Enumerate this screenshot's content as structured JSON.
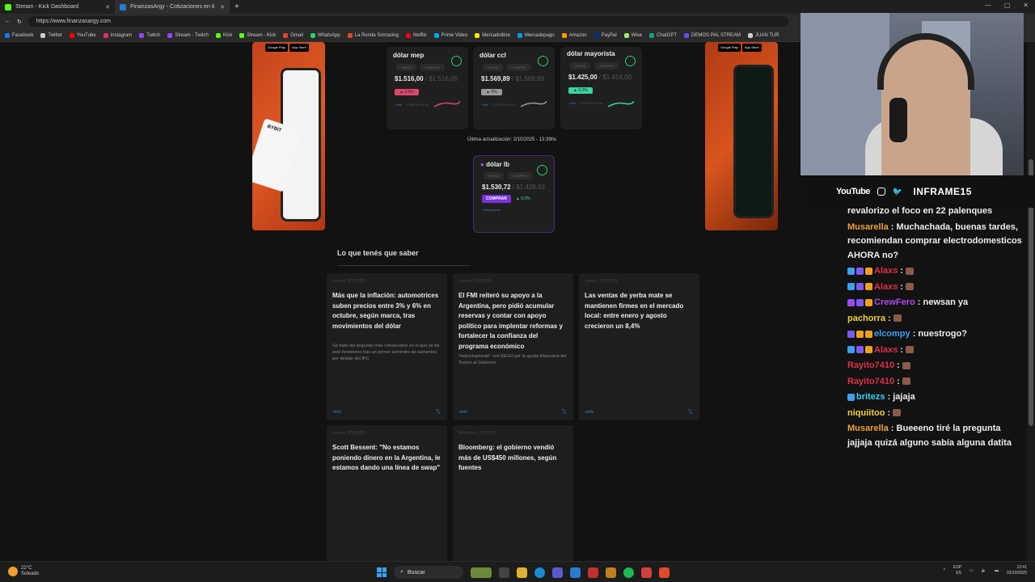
{
  "browser": {
    "tabs": [
      {
        "title": "Stream - Kick Dashboard",
        "active": false
      },
      {
        "title": "FinanzasArgy - Cotizaciones en ti",
        "active": true
      }
    ],
    "url": "https://www.finanzasargy.com",
    "bookmarks": [
      "Facebook",
      "Twitter",
      "YouTube",
      "Instagram",
      "Twitch",
      "Stream - Twitch",
      "Kick",
      "Stream - Kick",
      "Gmail",
      "WhatsApp",
      "La Ronda Simracing",
      "Netflix",
      "Prime Video",
      "Mercadolibre",
      "Mercadopago",
      "Amazon",
      "PayPal",
      "Wise",
      "ChatGPT",
      "DEMOS PAL STREAM",
      "JUAN TUR"
    ]
  },
  "ads": {
    "left_brand": "BYBIT",
    "store_google": "Google Play",
    "store_apple": "App Store"
  },
  "quotes": [
    {
      "name": "dólar mep",
      "venta_label": "VENTA",
      "compra_label": "COMPRA",
      "venta": "$1.516,00",
      "compra": "$1.516,00",
      "change": "0.0%",
      "change_color": "#e0456b",
      "spark_color": "#e0456b",
      "footer": "+Info",
      "footer2": "COMPRA 24 hs"
    },
    {
      "name": "dólar ccl",
      "venta_label": "VENTA",
      "compra_label": "COMPRA",
      "venta": "$1.569,89",
      "compra": "$1.569,89",
      "change": "0%",
      "change_color": "#9a9a9a",
      "spark_color": "#9a9a9a",
      "footer": "+Info",
      "footer2": "COMPRA 24 hs"
    },
    {
      "name": "dólar mayorista",
      "venta_label": "VENTA",
      "compra_label": "COMPRA",
      "venta": "$1.425,00",
      "compra": "$1.416,00",
      "change": "0.0%",
      "change_color": "#3ad6a0",
      "spark_color": "#3ad6a0",
      "footer": "+Info",
      "footer2": "COMPRA 24 hs"
    }
  ],
  "updated": "Última actualización: 2/10/2025 - 13:39hs",
  "lb": {
    "name": "dólar lb",
    "venta_label": "VENTA",
    "compra_label": "COMPRA",
    "venta": "$1.530,72",
    "compra": "$1.426,63",
    "buy": "COMPRAR",
    "change": "0.0%",
    "footer": "+Información"
  },
  "section_title": "Lo que tenés que saber",
  "news": [
    {
      "date": "Jueves, 2/10/2025",
      "head": "Más que la inflación: automotrices suben precios entre 3% y 6% en octubre, según marca, tras movimientos del dólar",
      "sum": "Se trata del segundo mes consecutivo en el que se da este fenómeno tras un primer semestre de aumentos por debajo del IPC",
      "more": "+Info"
    },
    {
      "date": "Jueves, 2/10/2025",
      "head": "El FMI reiteró su apoyo a la Argentina, pero pidió acumular reservas y contar con apoyo político para implentar reformas y fortalecer la confianza del programa económico",
      "sum": "\"estrechamente\" con EEUU por la ayuda financiera del Tesoro al Gobierno",
      "more": "+Info"
    },
    {
      "date": "Jueves, 2/10/2025",
      "head": "Las ventas de yerba mate se mantienen firmes en el mercado local: entre enero y agosto crecieron un 8,4%",
      "sum": "",
      "more": "+Info"
    },
    {
      "date": "Jueves, 2/10/2025",
      "head": "Scott Bessent: \"No estamos poniendo dinero en la Argentina, le estamos dando una línea de swap\"",
      "sum": "",
      "more": ""
    },
    {
      "date": "Miércoles, 1/10/2025",
      "head": "Bloomberg: el gobierno vendió más de US$450 millones, según fuentes",
      "sum": "",
      "more": ""
    }
  ],
  "stream": {
    "youtube": "YouTube",
    "handle": "INFRAME15"
  },
  "chat": [
    {
      "user": "",
      "color": "#eee",
      "text": "revalorizo el foco en 22 palenques",
      "badges": []
    },
    {
      "user": "Musarella",
      "color": "#f0a040",
      "text": "Muchachada, buenas tardes, recomiendan comprar electrodomesticos AHORA no?",
      "badges": []
    },
    {
      "user": "Alaxs",
      "color": "#e0304a",
      "text": "",
      "badges": [
        "#3aa0f0",
        "#7a5af0",
        "#f0a020"
      ],
      "emote": true
    },
    {
      "user": "Alaxs",
      "color": "#e0304a",
      "text": "",
      "badges": [
        "#3aa0f0",
        "#7a5af0",
        "#f0a020"
      ],
      "emote": true
    },
    {
      "user": "CrewFero",
      "color": "#b04af0",
      "text": "newsan ya",
      "badges": [
        "#9a4af0",
        "#7a5af0",
        "#f0a020"
      ]
    },
    {
      "user": "pachorra",
      "color": "#f0d040",
      "text": "",
      "badges": [],
      "emote": true
    },
    {
      "user": "elcompy",
      "color": "#3aa0f0",
      "text": "nuestrogo?",
      "badges": [
        "#7a5af0",
        "#f0a020",
        "#f0a020"
      ]
    },
    {
      "user": "Alaxs",
      "color": "#e0304a",
      "text": "",
      "badges": [
        "#3aa0f0",
        "#7a5af0",
        "#f0a020"
      ],
      "emote": true
    },
    {
      "user": "Rayito7410",
      "color": "#e0304a",
      "text": "",
      "badges": [],
      "emote": true
    },
    {
      "user": "Rayito7410",
      "color": "#e0304a",
      "text": "",
      "badges": [],
      "emote": true
    },
    {
      "user": "britezs",
      "color": "#3ad0f0",
      "text": "jajaja",
      "badges": [
        "#3aa0f0"
      ]
    },
    {
      "user": "niquiitoo",
      "color": "#f0d040",
      "text": "",
      "badges": [],
      "emote": true
    },
    {
      "user": "Musarella",
      "color": "#f0a040",
      "text": "Bueeeno tiré la pregunta jajjaja quizá alguno sabía alguna datita",
      "badges": []
    }
  ],
  "taskbar": {
    "temp": "22°C",
    "cond": "Soleado",
    "search": "Buscar",
    "lang1": "ESP",
    "lang2": "ES",
    "time": "13:41",
    "date": "02/10/2025"
  }
}
